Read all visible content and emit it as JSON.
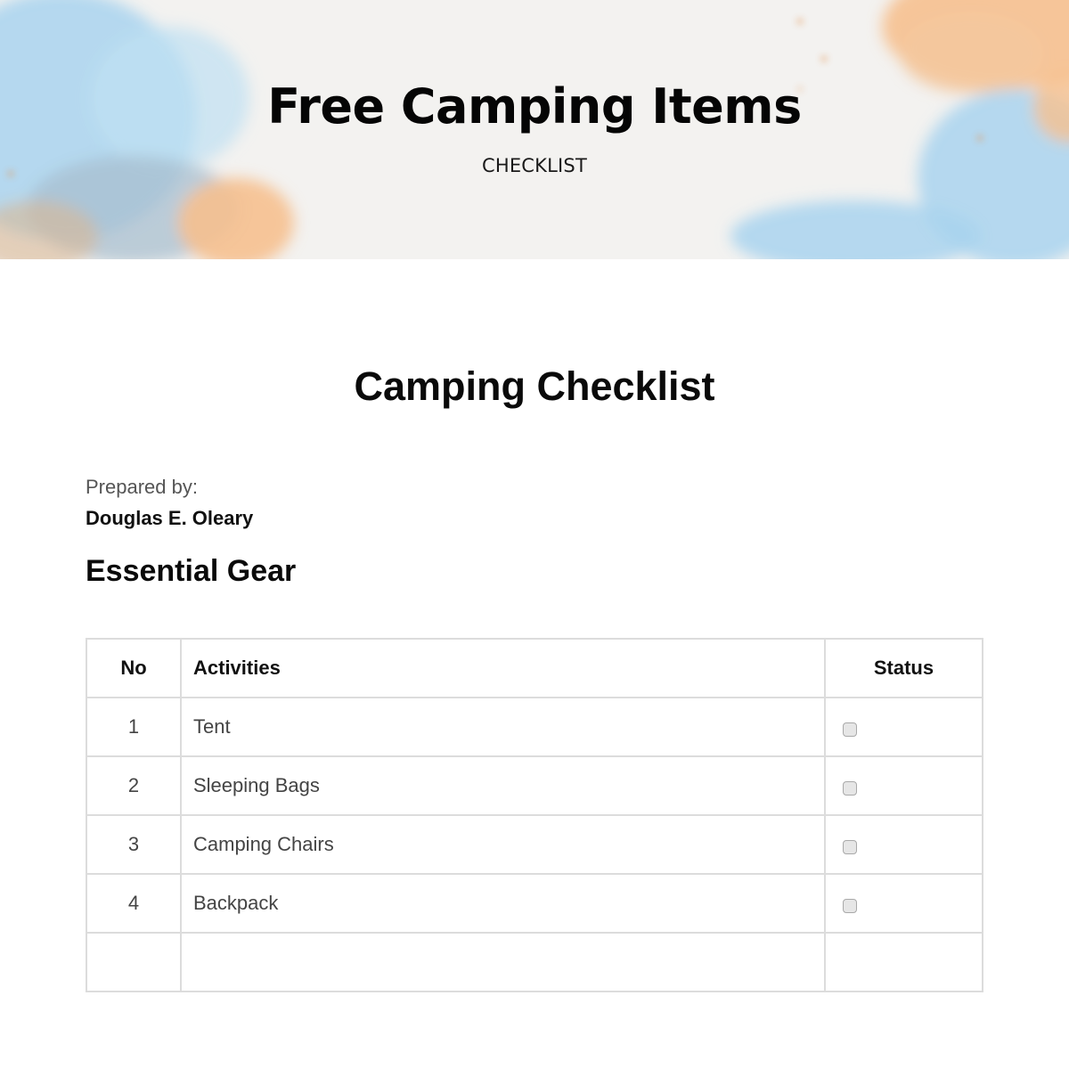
{
  "banner": {
    "title": "Free Camping Items",
    "subtitle": "CHECKLIST",
    "colors": {
      "blue": "#a9d3ef",
      "orange": "#f6c08f",
      "paper": "#f3f2f0"
    }
  },
  "document": {
    "title": "Camping Checklist",
    "prepared_by_label": "Prepared by:",
    "prepared_by_name": "Douglas E. Oleary",
    "section_title": "Essential Gear"
  },
  "table": {
    "headers": {
      "no": "No",
      "activities": "Activities",
      "status": "Status"
    },
    "rows": [
      {
        "no": "1",
        "activity": "Tent",
        "checked": false
      },
      {
        "no": "2",
        "activity": "Sleeping Bags",
        "checked": false
      },
      {
        "no": "3",
        "activity": "Camping Chairs",
        "checked": false
      },
      {
        "no": "4",
        "activity": "Backpack",
        "checked": false
      },
      {
        "no": "",
        "activity": "",
        "checked": null
      }
    ]
  }
}
